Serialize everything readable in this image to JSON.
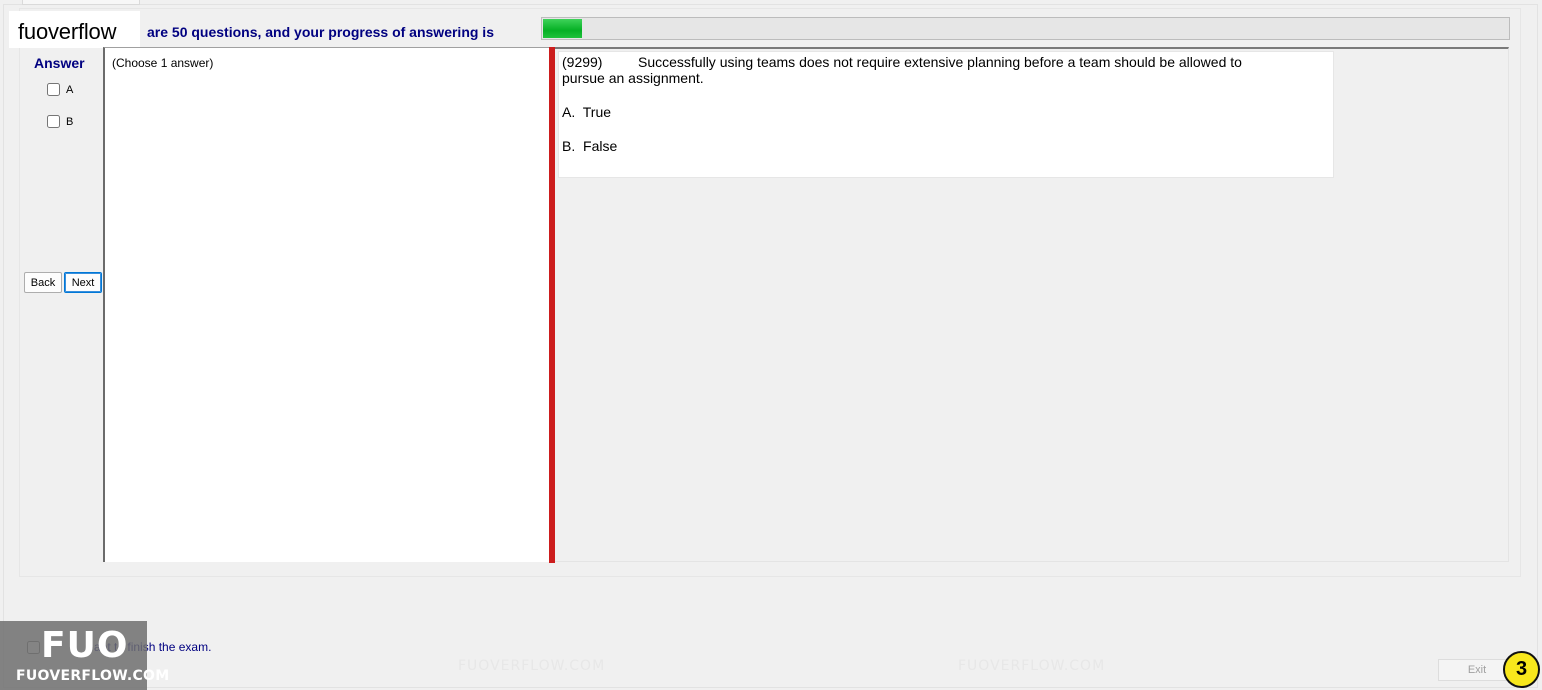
{
  "header": {
    "logo_text": "fuoverflow",
    "progress_text": "are 50 questions, and your progress of answering is",
    "progress_fraction": 0.04
  },
  "answer_panel": {
    "title": "Answer",
    "options": [
      {
        "label": "A",
        "checked": false
      },
      {
        "label": "B",
        "checked": false
      }
    ],
    "back_label": "Back",
    "next_label": "Next",
    "hint": "(Choose 1 answer)"
  },
  "question": {
    "id": "(9299)",
    "text": "Successfully using teams does not require extensive planning before a team should be allowed to",
    "text_cont": "pursue an assignment.",
    "options": [
      {
        "letter": "A.",
        "text": "True"
      },
      {
        "letter": "B.",
        "text": "False"
      }
    ]
  },
  "footer": {
    "finish_label_visible": "ant to finish the exam.",
    "exit_label": "Exit",
    "page_badge": "3"
  },
  "watermark": {
    "big": "FUO",
    "small": "FUOVERFLOW.COM",
    "bg_text": "FUOVERFLOW.COM"
  },
  "colors": {
    "accent_text": "#000080",
    "progress_fill": "#06b025",
    "splitter": "#cc1d1d",
    "badge": "#f8e71c"
  }
}
